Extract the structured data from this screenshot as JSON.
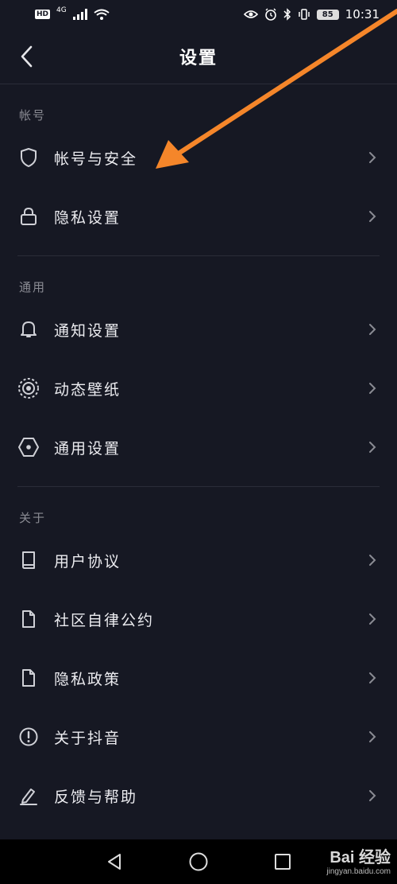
{
  "status_bar": {
    "hd": "HD",
    "network": "4G",
    "battery": "85",
    "time": "10:31"
  },
  "header": {
    "title": "设置"
  },
  "sections": [
    {
      "label": "帐号",
      "items": [
        {
          "label": "帐号与安全",
          "icon": "shield-icon"
        },
        {
          "label": "隐私设置",
          "icon": "lock-icon"
        }
      ]
    },
    {
      "label": "通用",
      "items": [
        {
          "label": "通知设置",
          "icon": "bell-icon"
        },
        {
          "label": "动态壁纸",
          "icon": "live-wallpaper-icon"
        },
        {
          "label": "通用设置",
          "icon": "hexagon-settings-icon"
        }
      ]
    },
    {
      "label": "关于",
      "items": [
        {
          "label": "用户协议",
          "icon": "book-icon"
        },
        {
          "label": "社区自律公约",
          "icon": "document-icon"
        },
        {
          "label": "隐私政策",
          "icon": "document-icon"
        },
        {
          "label": "关于抖音",
          "icon": "info-circle-icon"
        },
        {
          "label": "反馈与帮助",
          "icon": "edit-pen-icon"
        }
      ]
    }
  ],
  "watermark": {
    "logo": "Bai 经验",
    "url": "jingyan.baidu.com"
  },
  "colors": {
    "background": "#161823",
    "annotation_arrow": "#f5862a",
    "text_primary": "#ececf0",
    "text_secondary": "#8a8b93"
  }
}
